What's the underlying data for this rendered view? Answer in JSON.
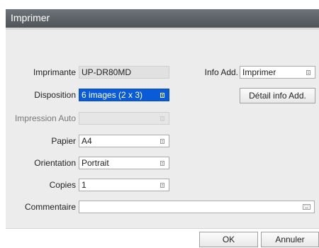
{
  "window": {
    "title": "Imprimer"
  },
  "form": {
    "printer": {
      "label": "Imprimante",
      "value": "UP-DR80MD"
    },
    "layout": {
      "label": "Disposition",
      "value": "6 images (2 x 3)"
    },
    "auto_print": {
      "label": "Impression Auto",
      "value": ""
    },
    "paper": {
      "label": "Papier",
      "value": "A4"
    },
    "orientation": {
      "label": "Orientation",
      "value": "Portrait"
    },
    "copies": {
      "label": "Copies",
      "value": "1"
    },
    "comment": {
      "label": "Commentaire",
      "value": ""
    },
    "info_add": {
      "label": "Info Add.",
      "value": "Imprimer"
    },
    "info_detail_button": "Détail info Add."
  },
  "buttons": {
    "ok": "OK",
    "cancel": "Annuler"
  },
  "colors": {
    "titlebar": "#5d6368",
    "selected": "#0a5cd6",
    "panel": "#ececec"
  }
}
